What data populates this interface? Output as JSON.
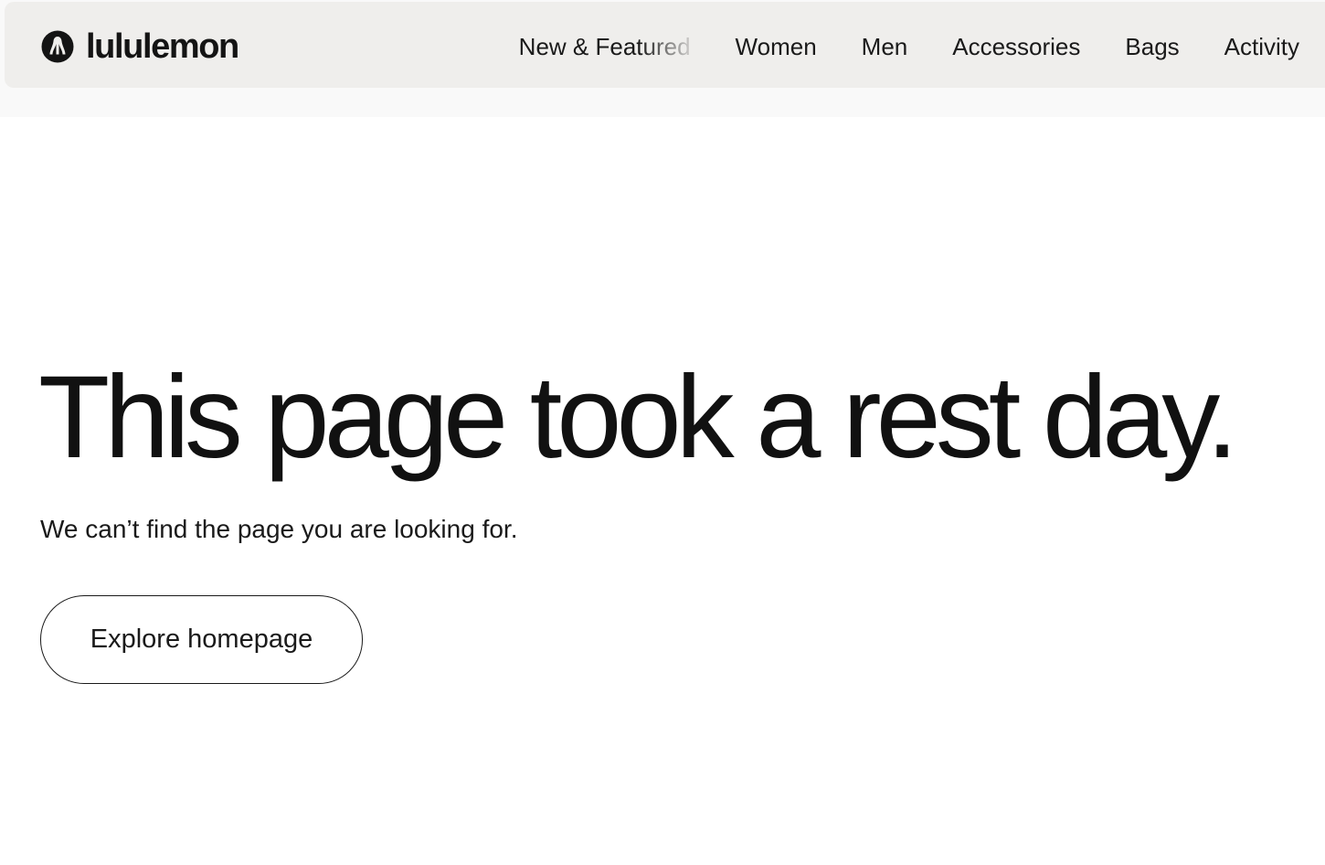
{
  "brand": {
    "name": "lululemon",
    "logo_icon": "lululemon-logo-icon"
  },
  "nav": {
    "items": [
      {
        "label": "New & Featured"
      },
      {
        "label": "Women"
      },
      {
        "label": "Men"
      },
      {
        "label": "Accessories"
      },
      {
        "label": "Bags"
      },
      {
        "label": "Activity"
      }
    ]
  },
  "main": {
    "headline": "This page took a rest day.",
    "subtext": "We can’t find the page you are looking for.",
    "cta_label": "Explore homepage"
  },
  "colors": {
    "header_bg": "#efeeec",
    "text": "#111111",
    "page_bg": "#ffffff"
  }
}
